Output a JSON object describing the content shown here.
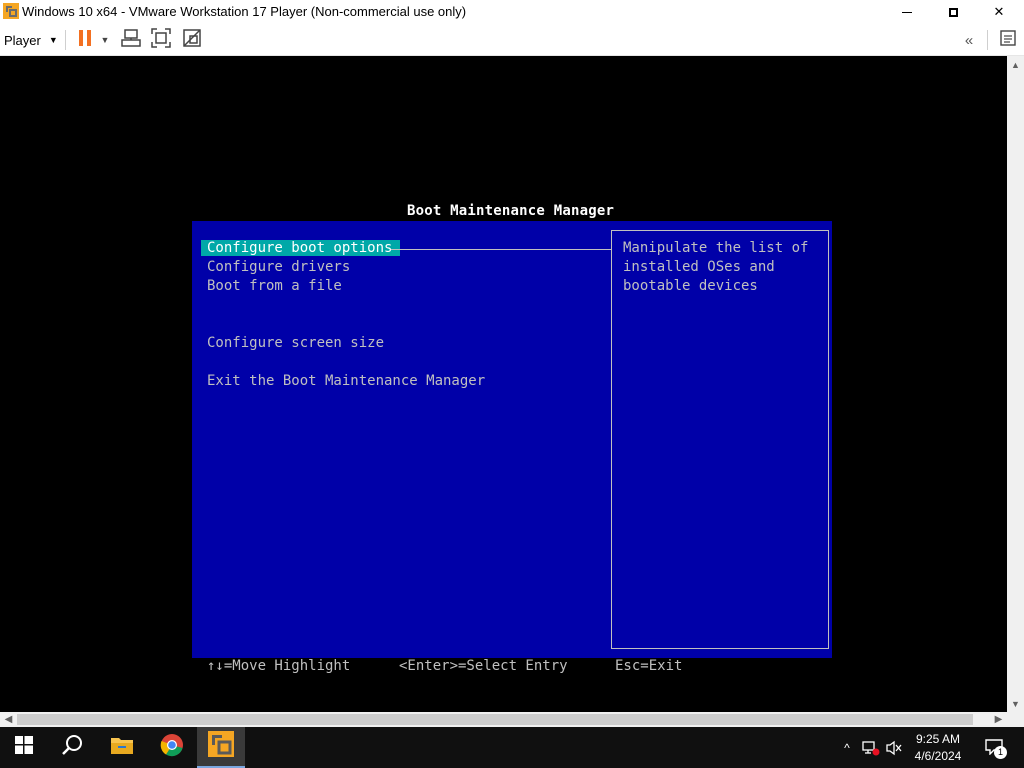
{
  "window": {
    "title": "Windows 10 x64 - VMware Workstation 17 Player (Non-commercial use only)",
    "minimize_glyph": "—",
    "maximize_glyph": "▢",
    "close_glyph": "✕"
  },
  "toolbar": {
    "player_label": "Player",
    "player_caret": "▼",
    "icons": [
      "pause-icon",
      "dropdown-caret-icon",
      "send-ctrl-alt-del-icon",
      "full-screen-icon",
      "unity-icon",
      "collapse-toolbar-icon",
      "message-log-icon"
    ],
    "collapse_glyph": "«"
  },
  "bios": {
    "title": "Boot Maintenance Manager",
    "menu": [
      {
        "label": "Configure boot options",
        "selected": true
      },
      {
        "label": "Configure drivers",
        "selected": false
      },
      {
        "label": "Boot from a file",
        "selected": false
      },
      {
        "label": "Configure screen size",
        "selected": false
      },
      {
        "label": "Exit the Boot Maintenance Manager",
        "selected": false
      }
    ],
    "help_lines": [
      "Manipulate the list of",
      "installed OSes and",
      "bootable devices"
    ],
    "footer": {
      "move": "↑↓=Move Highlight",
      "select": "<Enter>=Select Entry",
      "exit": "Esc=Exit"
    },
    "colors": {
      "background": "#0000a8",
      "highlight": "#00a8a8",
      "text": "#c0c0c0"
    }
  },
  "taskbar": {
    "icons": [
      "windows-start-icon",
      "search-icon",
      "file-explorer-icon",
      "chrome-icon",
      "vmware-player-icon"
    ],
    "tray_icons": [
      "show-hidden-icons-chevron",
      "network-disconnected-icon",
      "volume-muted-icon",
      "notifications-icon"
    ],
    "time": "9:25 AM",
    "date": "4/6/2024",
    "notification_count": "1",
    "chevron_glyph": "^"
  }
}
